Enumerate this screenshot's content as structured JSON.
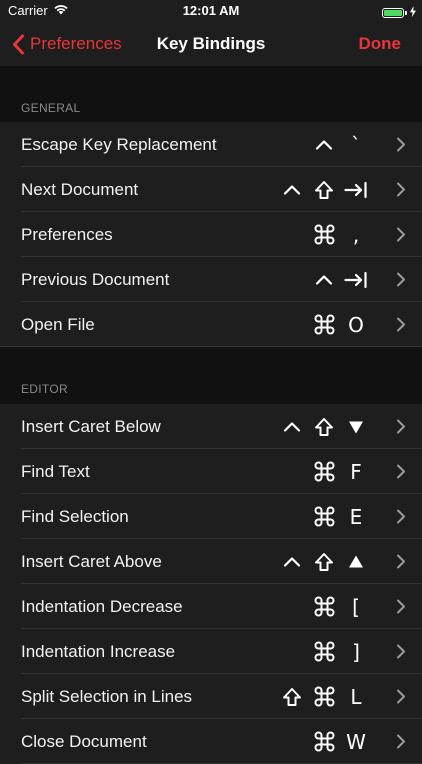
{
  "status": {
    "carrier": "Carrier",
    "time": "12:01 AM",
    "battery_level": 1.0
  },
  "nav": {
    "back_label": "Preferences",
    "title": "Key Bindings",
    "done_label": "Done"
  },
  "colors": {
    "accent": "#e8363c",
    "background": "#111111",
    "cell": "#1e1e1e",
    "section_text": "#8a8a8e"
  },
  "sections": [
    {
      "header": "GENERAL",
      "rows": [
        {
          "label": "Escape Key Replacement",
          "keys": [
            [
              "icon",
              "control-icon"
            ],
            [
              "text",
              "`"
            ]
          ]
        },
        {
          "label": "Next Document",
          "keys": [
            [
              "icon",
              "control-icon"
            ],
            [
              "icon",
              "shift-icon"
            ],
            [
              "icon",
              "tab-icon"
            ]
          ]
        },
        {
          "label": "Preferences",
          "keys": [
            [
              "icon",
              "command-icon"
            ],
            [
              "text",
              ","
            ]
          ]
        },
        {
          "label": "Previous Document",
          "keys": [
            [
              "icon",
              "control-icon"
            ],
            [
              "icon",
              "tab-icon"
            ]
          ]
        },
        {
          "label": "Open File",
          "keys": [
            [
              "icon",
              "command-icon"
            ],
            [
              "text",
              "O"
            ]
          ]
        }
      ]
    },
    {
      "header": "EDITOR",
      "rows": [
        {
          "label": "Insert Caret Below",
          "keys": [
            [
              "icon",
              "control-icon"
            ],
            [
              "icon",
              "shift-icon"
            ],
            [
              "icon",
              "arrow-down-icon"
            ]
          ]
        },
        {
          "label": "Find Text",
          "keys": [
            [
              "icon",
              "command-icon"
            ],
            [
              "text",
              "F"
            ]
          ]
        },
        {
          "label": "Find Selection",
          "keys": [
            [
              "icon",
              "command-icon"
            ],
            [
              "text",
              "E"
            ]
          ]
        },
        {
          "label": "Insert Caret Above",
          "keys": [
            [
              "icon",
              "control-icon"
            ],
            [
              "icon",
              "shift-icon"
            ],
            [
              "icon",
              "arrow-up-icon"
            ]
          ]
        },
        {
          "label": "Indentation Decrease",
          "keys": [
            [
              "icon",
              "command-icon"
            ],
            [
              "text",
              "["
            ]
          ]
        },
        {
          "label": "Indentation Increase",
          "keys": [
            [
              "icon",
              "command-icon"
            ],
            [
              "text",
              "]"
            ]
          ]
        },
        {
          "label": "Split Selection in Lines",
          "keys": [
            [
              "icon",
              "shift-icon"
            ],
            [
              "icon",
              "command-icon"
            ],
            [
              "text",
              "L"
            ]
          ]
        },
        {
          "label": "Close Document",
          "keys": [
            [
              "icon",
              "command-icon"
            ],
            [
              "text",
              "W"
            ]
          ]
        }
      ]
    }
  ]
}
